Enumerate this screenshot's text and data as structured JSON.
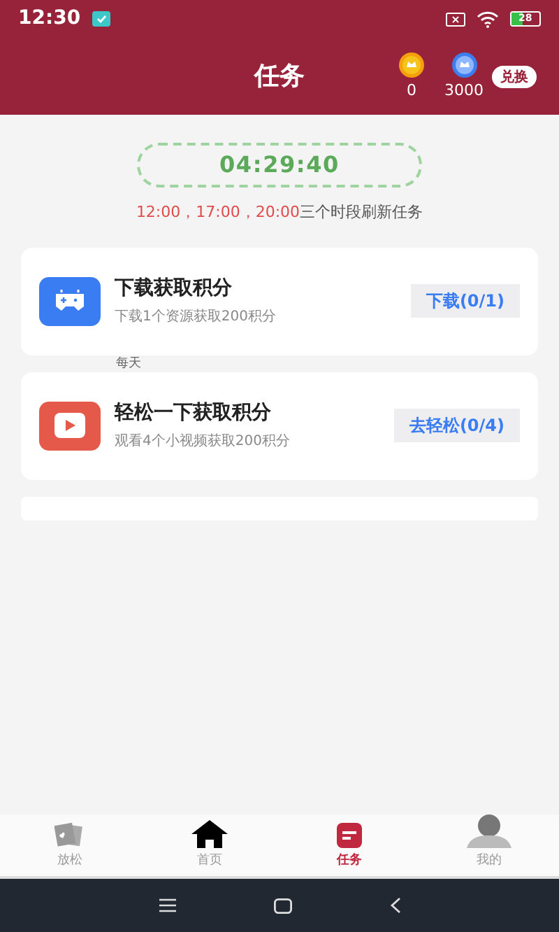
{
  "status_bar": {
    "time": "12:30",
    "battery": "28"
  },
  "header": {
    "title": "任务",
    "coins": [
      {
        "kind": "gold",
        "count": "0"
      },
      {
        "kind": "blue",
        "count": "3000"
      }
    ],
    "exchange_button": "兑换"
  },
  "timer": {
    "countdown": "04:29:40",
    "times": "12:00，17:00，20:00",
    "note": "三个时段刷新任务"
  },
  "tasks": [
    {
      "kind": "game",
      "title": "下载获取积分",
      "subtitle": "下载1个资源获取200积分",
      "button": "下载(0/1)"
    },
    {
      "kind": "video",
      "title": "轻松一下获取积分",
      "subtitle": "观看4个小视频获取200积分",
      "button": "去轻松(0/4)"
    }
  ],
  "hidden_label": "每天",
  "nav": [
    {
      "kind": "cards",
      "label": "放松",
      "selected": false
    },
    {
      "kind": "home",
      "label": "首页",
      "selected": false
    },
    {
      "kind": "task",
      "label": "任务",
      "selected": true
    },
    {
      "kind": "user",
      "label": "我的",
      "selected": false
    }
  ]
}
